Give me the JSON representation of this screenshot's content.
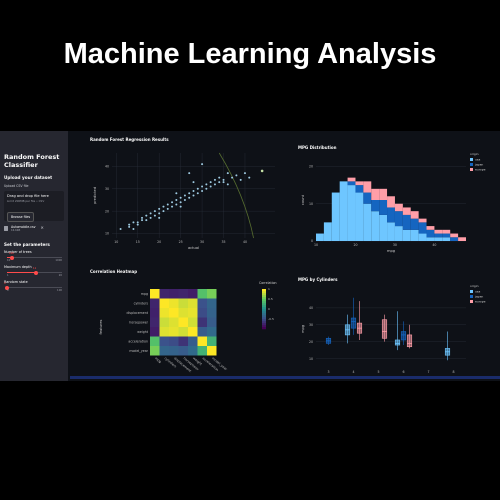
{
  "headline": "Machine Learning Analysis",
  "sidebar": {
    "title_line1": "Random Forest",
    "title_line2": "Classifier",
    "upload_heading": "Upload your dataset",
    "upload_label": "Upload CSV file",
    "dropzone_text": "Drag and drop file here",
    "dropzone_limit": "Limit 200MB per file • CSV",
    "browse_label": "Browse files",
    "file_name": "Automobile.csv",
    "file_size": "16.6KB",
    "params_heading": "Set the parameters",
    "sliders": [
      {
        "label": "Number of trees",
        "value": 100,
        "min": 10,
        "max": 1000
      },
      {
        "label": "Maximum depth",
        "value": 11,
        "min": 1,
        "max": 20
      },
      {
        "label": "Random state",
        "value": 0,
        "min": 0,
        "max": 100
      }
    ]
  },
  "colors": {
    "accent": "#ff4b4b",
    "scatter": "#9ecae1",
    "usa": "#6ec6ff",
    "japan": "#1565c0",
    "europe": "#ff9ea8"
  },
  "charts": {
    "regression": {
      "title": "Random Forest Regression Results",
      "xlabel": "actual",
      "ylabel": "predicted"
    },
    "mpg_distribution": {
      "title": "MPG Distribution",
      "xlabel": "mpg",
      "ylabel": "count",
      "legend_title": "origin",
      "legend": [
        "usa",
        "japan",
        "europe"
      ]
    },
    "heatmap": {
      "title": "Correlation Heatmap",
      "colorbar_title": "Correlation",
      "ylabel": "features"
    },
    "mpg_by_cylinders": {
      "title": "MPG by Cylinders",
      "ylabel": "mpg",
      "legend_title": "origin",
      "legend": [
        "usa",
        "japan",
        "europe"
      ]
    }
  },
  "chart_data": [
    {
      "type": "scatter",
      "title": "Random Forest Regression Results",
      "xlabel": "actual",
      "ylabel": "predicted",
      "xlim": [
        9,
        47
      ],
      "ylim": [
        8,
        46
      ],
      "x_ticks": [
        10,
        15,
        20,
        25,
        30,
        35,
        40
      ],
      "y_ticks": [
        10,
        20,
        30,
        40
      ],
      "points": [
        [
          11,
          12
        ],
        [
          13,
          13
        ],
        [
          13,
          14
        ],
        [
          14,
          15
        ],
        [
          15,
          15
        ],
        [
          15,
          14
        ],
        [
          16,
          16
        ],
        [
          16,
          17
        ],
        [
          17,
          16
        ],
        [
          17,
          18
        ],
        [
          18,
          17
        ],
        [
          18,
          19
        ],
        [
          19,
          20
        ],
        [
          19,
          18
        ],
        [
          20,
          19
        ],
        [
          20,
          21
        ],
        [
          21,
          20
        ],
        [
          21,
          22
        ],
        [
          22,
          21
        ],
        [
          22,
          23
        ],
        [
          23,
          24
        ],
        [
          23,
          22
        ],
        [
          24,
          25
        ],
        [
          24,
          23
        ],
        [
          25,
          26
        ],
        [
          25,
          24
        ],
        [
          26,
          27
        ],
        [
          26,
          25
        ],
        [
          27,
          28
        ],
        [
          27,
          26
        ],
        [
          28,
          29
        ],
        [
          28,
          27
        ],
        [
          29,
          30
        ],
        [
          29,
          28
        ],
        [
          30,
          31
        ],
        [
          30,
          29
        ],
        [
          31,
          32
        ],
        [
          31,
          30
        ],
        [
          32,
          33
        ],
        [
          32,
          31
        ],
        [
          33,
          32
        ],
        [
          33,
          34
        ],
        [
          34,
          33
        ],
        [
          34,
          35
        ],
        [
          35,
          34
        ],
        [
          35,
          33
        ],
        [
          36,
          32
        ],
        [
          37,
          35
        ],
        [
          38,
          36
        ],
        [
          39,
          34
        ],
        [
          40,
          37
        ],
        [
          41,
          35
        ],
        [
          27,
          37
        ],
        [
          30,
          41
        ],
        [
          36,
          37
        ],
        [
          14,
          12
        ],
        [
          20,
          17
        ],
        [
          25,
          22
        ],
        [
          28,
          33
        ],
        [
          24,
          28
        ]
      ],
      "highlight_points": [
        [
          44,
          38
        ]
      ]
    },
    {
      "type": "bar",
      "title": "MPG Distribution",
      "xlabel": "mpg",
      "ylabel": "count",
      "stacked": true,
      "x_ticks": [
        10,
        20,
        30,
        40
      ],
      "categories": [
        "10",
        "12",
        "14",
        "16",
        "18",
        "20",
        "22",
        "24",
        "26",
        "28",
        "30",
        "32",
        "34",
        "36",
        "38",
        "40",
        "42",
        "44",
        "46"
      ],
      "series": [
        {
          "name": "usa",
          "values": [
            2,
            5,
            13,
            16,
            15,
            13,
            10,
            8,
            7,
            5,
            4,
            3,
            3,
            2,
            1,
            1,
            1,
            0,
            0
          ]
        },
        {
          "name": "japan",
          "values": [
            0,
            0,
            0,
            0,
            1,
            2,
            3,
            3,
            4,
            4,
            4,
            4,
            3,
            3,
            2,
            1,
            1,
            1,
            0
          ]
        },
        {
          "name": "europe",
          "values": [
            0,
            0,
            0,
            0,
            1,
            1,
            3,
            3,
            3,
            3,
            2,
            2,
            2,
            1,
            1,
            1,
            1,
            1,
            1
          ]
        }
      ],
      "y_ticks": [
        0,
        10,
        20
      ],
      "ylim": [
        0,
        22
      ]
    },
    {
      "type": "heatmap",
      "title": "Correlation Heatmap",
      "rows": [
        "mpg",
        "cylinders",
        "displacement",
        "horsepower",
        "weight",
        "acceleration",
        "model_year"
      ],
      "cols": [
        "mpg",
        "cylinders",
        "displacement",
        "horsepower",
        "weight",
        "acceleration",
        "model_year"
      ],
      "values": [
        [
          1.0,
          -0.78,
          -0.8,
          -0.78,
          -0.83,
          0.42,
          0.58
        ],
        [
          -0.78,
          1.0,
          0.95,
          0.84,
          0.9,
          -0.5,
          -0.35
        ],
        [
          -0.8,
          0.95,
          1.0,
          0.9,
          0.93,
          -0.54,
          -0.37
        ],
        [
          -0.78,
          0.84,
          0.9,
          1.0,
          0.86,
          -0.69,
          -0.42
        ],
        [
          -0.83,
          0.9,
          0.93,
          0.86,
          1.0,
          -0.42,
          -0.31
        ],
        [
          0.42,
          -0.5,
          -0.54,
          -0.69,
          -0.42,
          1.0,
          0.29
        ],
        [
          0.58,
          -0.35,
          -0.37,
          -0.42,
          -0.31,
          0.29,
          1.0
        ]
      ],
      "colorbar_ticks": [
        1,
        0.5,
        0,
        -0.5
      ]
    },
    {
      "type": "box",
      "title": "MPG by Cylinders",
      "ylabel": "mpg",
      "x_ticks": [
        "3",
        "4",
        "5",
        "6",
        "7",
        "8"
      ],
      "y_ticks": [
        10,
        20,
        30,
        40
      ],
      "ylim": [
        5,
        50
      ],
      "boxes": [
        {
          "cyl": 3,
          "origin": "japan",
          "min": 18,
          "q1": 19,
          "median": 20.5,
          "q3": 22,
          "max": 23
        },
        {
          "cyl": 4,
          "origin": "usa",
          "min": 19,
          "q1": 24,
          "median": 27,
          "q3": 30,
          "max": 36
        },
        {
          "cyl": 4,
          "origin": "japan",
          "min": 24,
          "q1": 28,
          "median": 32,
          "q3": 34,
          "max": 46
        },
        {
          "cyl": 4,
          "origin": "europe",
          "min": 21,
          "q1": 25,
          "median": 28,
          "q3": 31,
          "max": 44
        },
        {
          "cyl": 5,
          "origin": "europe",
          "min": 20,
          "q1": 22,
          "median": 26,
          "q3": 33,
          "max": 36
        },
        {
          "cyl": 6,
          "origin": "usa",
          "min": 15,
          "q1": 18,
          "median": 19,
          "q3": 21,
          "max": 38
        },
        {
          "cyl": 6,
          "origin": "japan",
          "min": 18,
          "q1": 21,
          "median": 24,
          "q3": 26,
          "max": 32
        },
        {
          "cyl": 6,
          "origin": "europe",
          "min": 16,
          "q1": 17,
          "median": 19,
          "q3": 24,
          "max": 30
        },
        {
          "cyl": 8,
          "origin": "usa",
          "min": 9,
          "q1": 12,
          "median": 14,
          "q3": 16,
          "max": 26
        }
      ]
    }
  ]
}
